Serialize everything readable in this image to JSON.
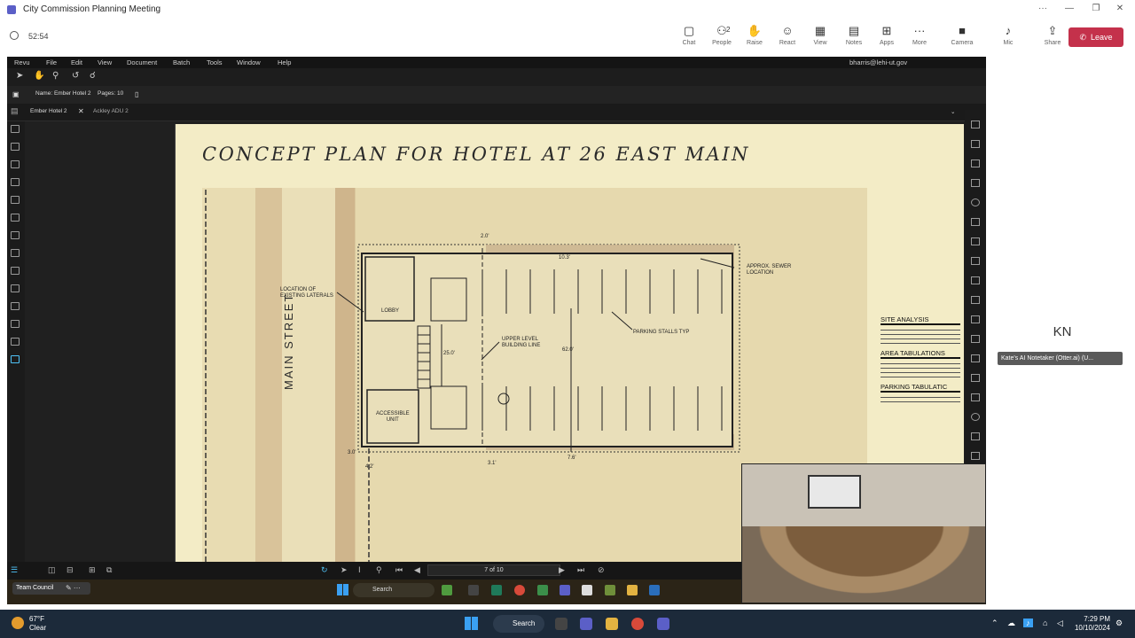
{
  "teams": {
    "window_title": "City Commission Planning Meeting",
    "timer": "52:54",
    "toolbar": [
      {
        "label": "Chat",
        "icon": "chat-icon",
        "glyph": "▢"
      },
      {
        "label": "People",
        "icon": "people-icon",
        "glyph": "⚇",
        "badge": "2"
      },
      {
        "label": "Raise",
        "icon": "raise-hand-icon",
        "glyph": "✋"
      },
      {
        "label": "React",
        "icon": "react-icon",
        "glyph": "☺"
      },
      {
        "label": "View",
        "icon": "view-icon",
        "glyph": "▦"
      },
      {
        "label": "Notes",
        "icon": "notes-icon",
        "glyph": "▤"
      },
      {
        "label": "Apps",
        "icon": "apps-icon",
        "glyph": "⊞"
      },
      {
        "label": "More",
        "icon": "more-icon",
        "glyph": "···"
      },
      {
        "label": "Camera",
        "icon": "camera-icon",
        "glyph": "■"
      },
      {
        "label": "Mic",
        "icon": "mic-icon",
        "glyph": "♪"
      },
      {
        "label": "Share",
        "icon": "share-icon",
        "glyph": "⇪"
      }
    ],
    "leave_label": "Leave",
    "participant_initials": "KN",
    "participant_name": "Kate's AI Notetaker (Otter.ai) (U..."
  },
  "revu": {
    "menu": [
      "Revu",
      "File",
      "Edit",
      "View",
      "Document",
      "Batch",
      "Tools",
      "Window",
      "Help"
    ],
    "user": "bharris@lehi-ut.gov",
    "doc_name": "Name: Ember Hotel 2",
    "pages": "Pages: 10",
    "tabs": [
      "Ember Hotel 2",
      "Ackley ADU 2"
    ],
    "page_indicator": "7 of 10"
  },
  "drawing": {
    "title": "CONCEPT PLAN FOR HOTEL AT 26 EAST MAIN",
    "street_label": "MAIN STREET",
    "labels": {
      "laterals": "LOCATION OF\nEXISTING LATERALS",
      "lobby": "LOBBY",
      "accessible": "ACCESSIBLE\nUNIT",
      "upper_level": "UPPER LEVEL\nBUILDING LINE",
      "parking": "PARKING STALLS TYP",
      "sewer": "APPROX. SEWER\nLOCATION",
      "dim_top": "2.0'",
      "dim_10": "10.3'",
      "dim_25": "25.0'",
      "dim_62": "62.0'",
      "dim_30": "3.0'",
      "dim_42": "4.2'",
      "dim_31": "3.1'",
      "dim_76": "7.6'"
    },
    "site_headers": [
      "SITE ANALYSIS",
      "AREA TABULATIONS",
      "PARKING TABULATIC"
    ]
  },
  "inner_taskbar": {
    "team_label": "Team Council",
    "search_label": "Search"
  },
  "taskbar": {
    "temperature": "67°F",
    "condition": "Clear",
    "search_label": "Search",
    "time": "7:29 PM",
    "date": "10/10/2024"
  },
  "colors": {
    "leave": "#c4314b",
    "teams_accent": "#5b5fc7",
    "sheet": "#f3ecc6"
  }
}
